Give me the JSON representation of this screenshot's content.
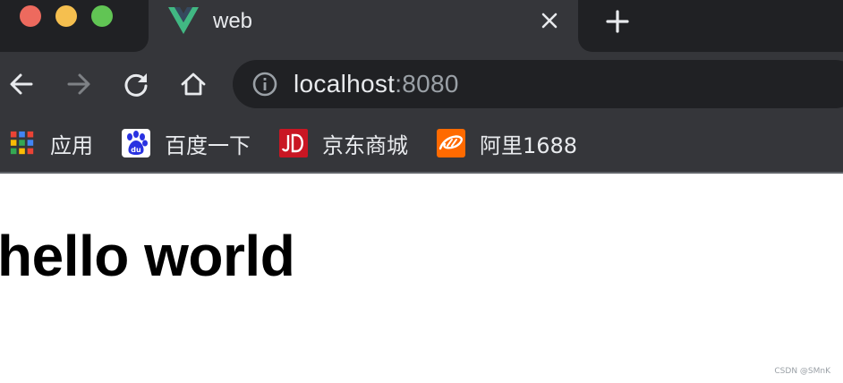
{
  "window": {
    "traffic_lights": {
      "close": "#ed6a5e",
      "minimize": "#f5bf4f",
      "zoom": "#61c554"
    }
  },
  "tab": {
    "title": "web",
    "favicon": "vue-logo-icon",
    "close_icon": "close-icon"
  },
  "new_tab": {
    "icon": "plus-icon"
  },
  "toolbar": {
    "back_icon": "arrow-left-icon",
    "forward_icon": "arrow-right-icon",
    "reload_icon": "reload-icon",
    "home_icon": "home-icon",
    "address": {
      "info_icon": "info-icon",
      "host": "localhost",
      "port": ":8080"
    }
  },
  "bookmarks": [
    {
      "label": "应用",
      "icon": "apps-grid-icon"
    },
    {
      "label": "百度一下",
      "icon": "baidu-icon"
    },
    {
      "label": "京东商城",
      "icon": "jd-icon"
    },
    {
      "label": "阿里1688",
      "icon": "alibaba-1688-icon"
    }
  ],
  "page": {
    "heading": "hello world"
  },
  "watermark": "CSDN @SMnK",
  "colors": {
    "titlebar_bg": "#202124",
    "toolbar_bg": "#35363a",
    "omnibox_bg": "#202124",
    "text_light": "#e8eaed",
    "text_dim": "#9aa0a6",
    "vue_green": "#41b883",
    "vue_dark": "#35495e",
    "baidu_blue": "#2932e1",
    "jd_red": "#c91623",
    "ali_orange": "#ff6a00"
  }
}
